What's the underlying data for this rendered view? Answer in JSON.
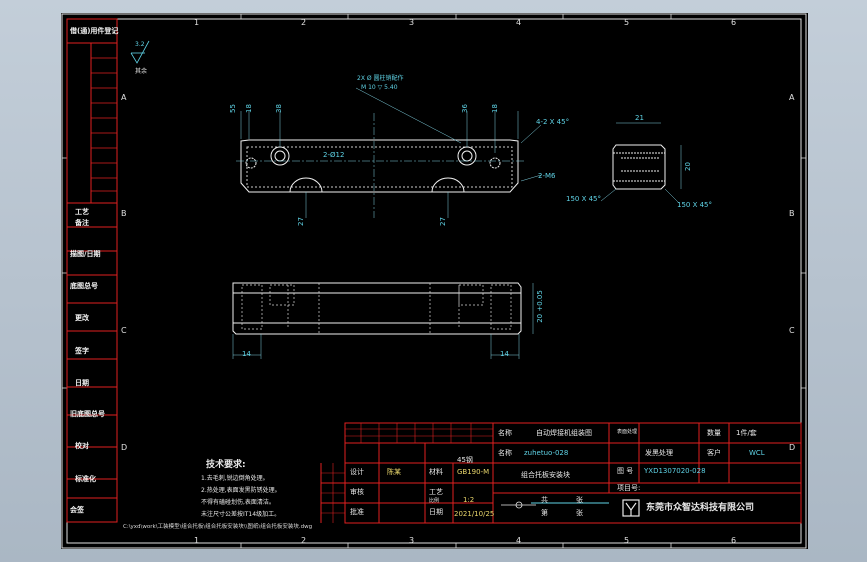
{
  "window": {
    "background": "#b7c3cf",
    "canvas_color": "#000000",
    "border_red": "#e02020"
  },
  "column_markers": [
    "1",
    "2",
    "3",
    "4",
    "5",
    "6"
  ],
  "row_markers": [
    "A",
    "B",
    "C",
    "D"
  ],
  "left_title_block": [
    "借(通)用件登记",
    "工艺",
    "备注",
    "描图/日期",
    "底图总号",
    "更改",
    "签字",
    "日期",
    "旧底图总号",
    "校对",
    "标准化",
    "会签"
  ],
  "surface_finish": {
    "value": "3.2",
    "label": "其余"
  },
  "dimensions": {
    "top_view": [
      "55",
      "18",
      "38",
      "36",
      "18",
      "4-2 X 45°",
      "2-M6",
      "2-Ø12",
      "27",
      "27",
      "2X Ø 圆柱销配作",
      "M 10 ▽ 5.40"
    ],
    "side_view": [
      "21",
      "20",
      "150 X 45°",
      "150 X 45°"
    ],
    "front_view": [
      "20 +0.05",
      "14",
      "14"
    ]
  },
  "tech_requirements": {
    "title": "技术要求:",
    "lines": [
      "1.去毛刺,锐边倒角处理。",
      "2.热处理,表面发黑防锈处理。",
      "不得有磕碰划伤,表面清洁。",
      "未注尺寸公差按IT14级加工。"
    ]
  },
  "title_block": {
    "project_label": "名称",
    "project_value": "自动焊接机组装图",
    "part_code": "zuhetuo-028",
    "part_name_label": "名称",
    "part_name": "组合托板安装块",
    "designer_label": "设计",
    "designer_name": "陈某",
    "material_label": "材料",
    "material_value": "45钢",
    "standard": "GB190-M",
    "check_label": "审核",
    "approve_label": "批准",
    "craft_label": "工艺",
    "date_label": "日期",
    "scale_label": "比例",
    "scale_value": "1:2",
    "date": "2021/10/25",
    "qty_label": "数量",
    "qty_value": "1件/套",
    "customer_label": "客户",
    "customer_value": "WCL",
    "surface_label": "表面处理",
    "surface_value": "发黑处理",
    "drawing_no_label": "图 号",
    "drawing_no": "YXD1307020-028",
    "project_no_label": "项目号:",
    "sheet": [
      "共",
      "张",
      "第",
      "张"
    ],
    "company": "东莞市众智达科技有限公司"
  },
  "file_path": "C:\\yxd\\work\\工装模型\\组合托板\\组合托板安装块\\\\图纸\\组合托板安装块.dwg"
}
